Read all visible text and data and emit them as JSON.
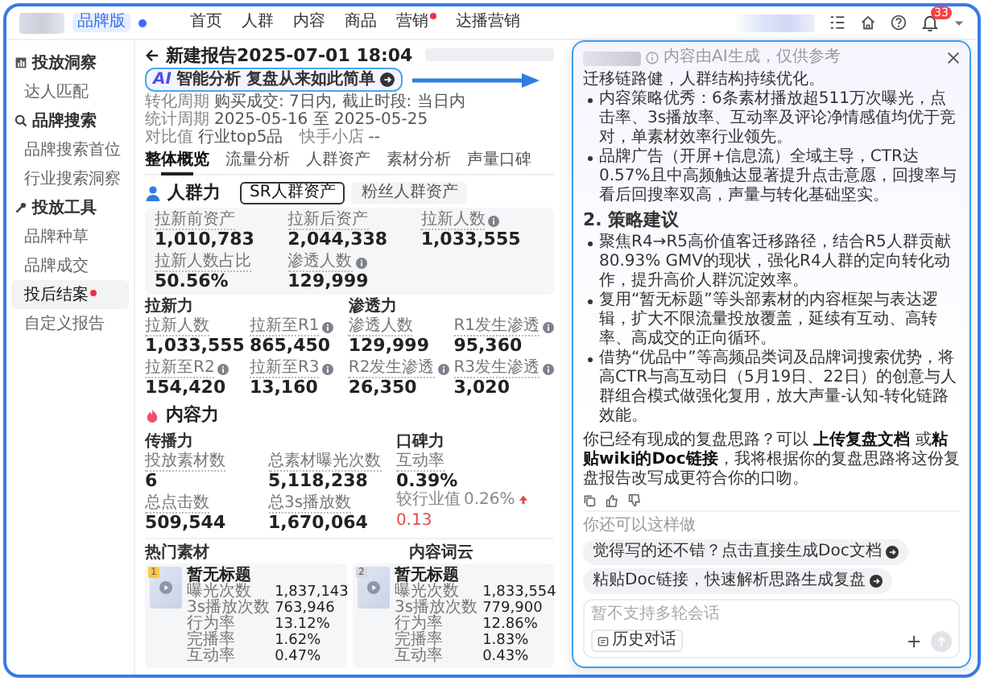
{
  "top_bar": {
    "badge": "品牌版",
    "nav": [
      {
        "label": "首页",
        "dot": false
      },
      {
        "label": "人群",
        "dot": false
      },
      {
        "label": "内容",
        "dot": false
      },
      {
        "label": "商品",
        "dot": false
      },
      {
        "label": "营销",
        "dot": true
      },
      {
        "label": "达播营销",
        "dot": false
      }
    ],
    "notification_count": "33"
  },
  "sidebar": {
    "groups": [
      {
        "title": "投放洞察",
        "items": [
          {
            "label": "达人匹配",
            "selected": false,
            "dot": false
          }
        ]
      },
      {
        "title": "品牌搜索",
        "items": [
          {
            "label": "品牌搜索首位",
            "selected": false,
            "dot": false
          },
          {
            "label": "行业搜索洞察",
            "selected": false,
            "dot": false
          }
        ]
      },
      {
        "title": "投放工具",
        "items": [
          {
            "label": "品牌种草",
            "selected": false,
            "dot": false
          },
          {
            "label": "品牌成交",
            "selected": false,
            "dot": false
          },
          {
            "label": "投后结案",
            "selected": true,
            "dot": true
          },
          {
            "label": "自定义报告",
            "selected": false,
            "dot": false
          }
        ]
      }
    ]
  },
  "report": {
    "title": "新建报告2025-07-01 18:04",
    "ai_badge": "AI",
    "ai_button": "智能分析 复盘从来如此简单",
    "meta": [
      {
        "label": "转化周期",
        "value": "购买成交: 7日内, 截止时段: 当日内"
      },
      {
        "label": "统计周期",
        "value": "2025-05-16 至 2025-05-25"
      },
      {
        "label": "对比值",
        "value": "行业top5品"
      },
      {
        "label": "快手小店",
        "value": "--"
      }
    ]
  },
  "tabs": [
    {
      "label": "整体概览",
      "selected": true
    },
    {
      "label": "流量分析",
      "selected": false
    },
    {
      "label": "人群资产",
      "selected": false
    },
    {
      "label": "素材分析",
      "selected": false
    },
    {
      "label": "声量口碑",
      "selected": false
    }
  ],
  "crowd": {
    "title": "人群力",
    "segments": [
      {
        "label": "SR人群资产",
        "selected": true
      },
      {
        "label": "粉丝人群资产",
        "selected": false
      }
    ],
    "summary": [
      {
        "label": "拉新前资产",
        "value": "1,010,783",
        "info": false
      },
      {
        "label": "拉新后资产",
        "value": "2,044,338",
        "info": false
      },
      {
        "label": "拉新人数",
        "value": "1,033,555",
        "info": true
      },
      {
        "label": "拉新人数占比",
        "value": "50.56%",
        "info": false
      },
      {
        "label": "渗透人数",
        "value": "129,999",
        "info": true
      }
    ],
    "groups": [
      {
        "title": "拉新力",
        "metrics": [
          {
            "label": "拉新人数",
            "value": "1,033,555",
            "info": false
          },
          {
            "label": "拉新至R1",
            "value": "865,450",
            "info": true
          },
          {
            "label": "拉新至R2",
            "value": "154,420",
            "info": true
          },
          {
            "label": "拉新至R3",
            "value": "13,160",
            "info": true
          }
        ]
      },
      {
        "title": "渗透力",
        "metrics": [
          {
            "label": "渗透人数",
            "value": "129,999",
            "info": false
          },
          {
            "label": "R1发生渗透",
            "value": "95,360",
            "info": true
          },
          {
            "label": "R2发生渗透",
            "value": "26,350",
            "info": true
          },
          {
            "label": "R3发生渗透",
            "value": "3,020",
            "info": true
          }
        ]
      }
    ]
  },
  "content": {
    "title": "内容力",
    "spread": {
      "title": "传播力",
      "metrics": [
        {
          "label": "投放素材数",
          "value": "6",
          "info": false
        },
        {
          "label": "总素材曝光次数",
          "value": "5,118,238",
          "info": false
        },
        {
          "label": "总点击数",
          "value": "509,544",
          "info": false
        },
        {
          "label": "总3s播放数",
          "value": "1,670,064",
          "info": false
        }
      ]
    },
    "reputation": {
      "title": "口碑力",
      "label": "互动率",
      "value": "0.39%",
      "compare_label": "较行业值",
      "compare_value": "0.26%",
      "rising": true,
      "delta": "0.13"
    }
  },
  "hot_materials": {
    "title": "热门素材",
    "items": [
      {
        "rank": "1",
        "color": "#f7c948",
        "title": "暂无标题",
        "stats": [
          {
            "label": "曝光次数",
            "value": "1,837,143"
          },
          {
            "label": "3s播放次数",
            "value": "763,946"
          },
          {
            "label": "行为率",
            "value": "13.12%"
          },
          {
            "label": "完播率",
            "value": "1.62%"
          },
          {
            "label": "互动率",
            "value": "0.47%"
          }
        ]
      },
      {
        "rank": "2",
        "color": "#d5d9e0",
        "title": "暂无标题",
        "stats": [
          {
            "label": "曝光次数",
            "value": "1,833,554"
          },
          {
            "label": "3s播放次数",
            "value": "779,900"
          },
          {
            "label": "行为率",
            "value": "12.86%"
          },
          {
            "label": "完播率",
            "value": "1.83%"
          },
          {
            "label": "互动率",
            "value": "0.43%"
          }
        ]
      }
    ]
  },
  "word_cloud": {
    "title": "内容词云"
  },
  "ai_panel": {
    "notice": "内容由AI生成，仅供参考",
    "intro": "迁移链路健，人群结构持续优化。",
    "bullets_1": [
      "内容策略优秀：6条素材播放超511万次曝光，点击率、3s播放率、互动率及评论净情感值均优于竞对，单素材效率行业领先。",
      "品牌广告（开屏+信息流）全域主导，CTR达0.57%且中高频触达显著提升点击意愿，回搜率与看后回搜率双高，声量与转化基础坚实。"
    ],
    "heading": "2. 策略建议",
    "bullets_2": [
      "聚焦R4→R5高价值客迁移路径，结合R5人群贡献80.93% GMV的现状，强化R4人群的定向转化动作，提升高价人群沉淀效率。",
      "复用“暂无标题”等头部素材的内容框架与表达逻辑，扩大不限流量投放覆盖，延续有互动、高转率、高成交的正向循环。",
      "借势“优品中”等高频品类词及品牌词搜索优势，将高CTR与高互动日（5月19日、22日）的创意与人群组合模式做强化复用，放大声量-认知-转化链路效能。"
    ],
    "question": "你已经有现成的复盘思路？可以 **上传复盘文档** 或**粘贴wiki的Doc链接**，我将根据你的复盘思路将这份复盘报告改写成更符合你的口吻。",
    "suggest_label": "你还可以这样做",
    "suggestions": [
      "觉得写的还不错？点击直接生成Doc文档",
      "粘贴Doc链接，快速解析思路生成复盘"
    ],
    "input": {
      "placeholder": "暂不支持多轮会话"
    },
    "history_button": "历史对话",
    "send_disabled": true
  }
}
